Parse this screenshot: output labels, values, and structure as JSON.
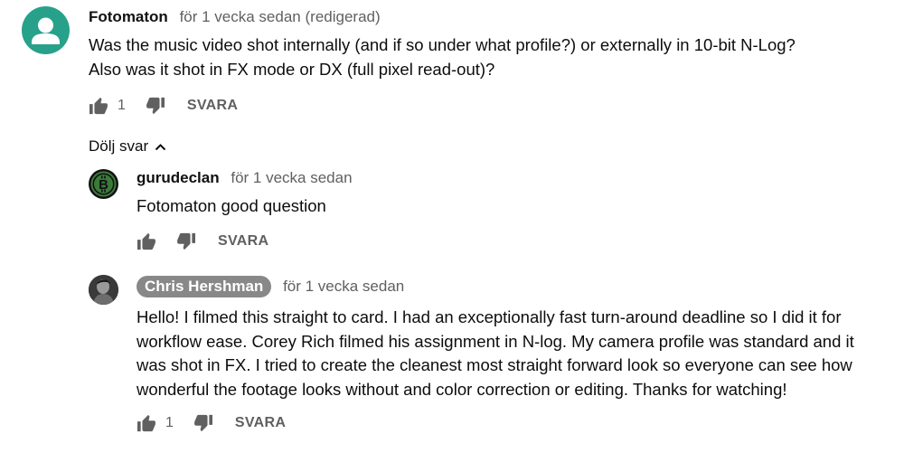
{
  "comments": {
    "main": {
      "author": "Fotomaton",
      "time": "för 1 vecka sedan",
      "edited": "(redigerad)",
      "lines": [
        "Was the music video shot internally (and if so under what profile?) or externally in 10-bit N-Log?",
        "Also was it shot in FX mode or DX (full pixel read-out)?"
      ],
      "likes": "1",
      "reply_label": "SVARA"
    },
    "toggle_label": "Dölj svar",
    "replies": [
      {
        "author": "gurudeclan",
        "time": "för 1 vecka sedan",
        "lines": [
          "Fotomaton good question"
        ],
        "likes": "",
        "reply_label": "SVARA"
      },
      {
        "author": "Chris Hershman",
        "time": "för 1 vecka sedan",
        "lines": [
          "Hello! I filmed this straight to card. I had an exceptionally fast turn-around deadline so I did it for",
          "workflow ease. Corey Rich filmed his assignment in N-log. My camera profile was standard and it",
          "was shot in FX. I tried to create the cleanest most straight forward look so everyone can see how",
          "wonderful the footage looks without and color correction or editing. Thanks for watching!"
        ],
        "likes": "1",
        "reply_label": "SVARA"
      }
    ]
  },
  "icons": [
    "avatar-default-icon",
    "bitcoin-avatar-icon",
    "thumbs-up-icon",
    "thumbs-down-icon",
    "chevron-up-icon"
  ],
  "colors": {
    "avatar_teal": "#27a18a",
    "meta_gray": "#606060",
    "owner_badge": "#888888",
    "bitcoin_green": "#3c7a3c"
  }
}
